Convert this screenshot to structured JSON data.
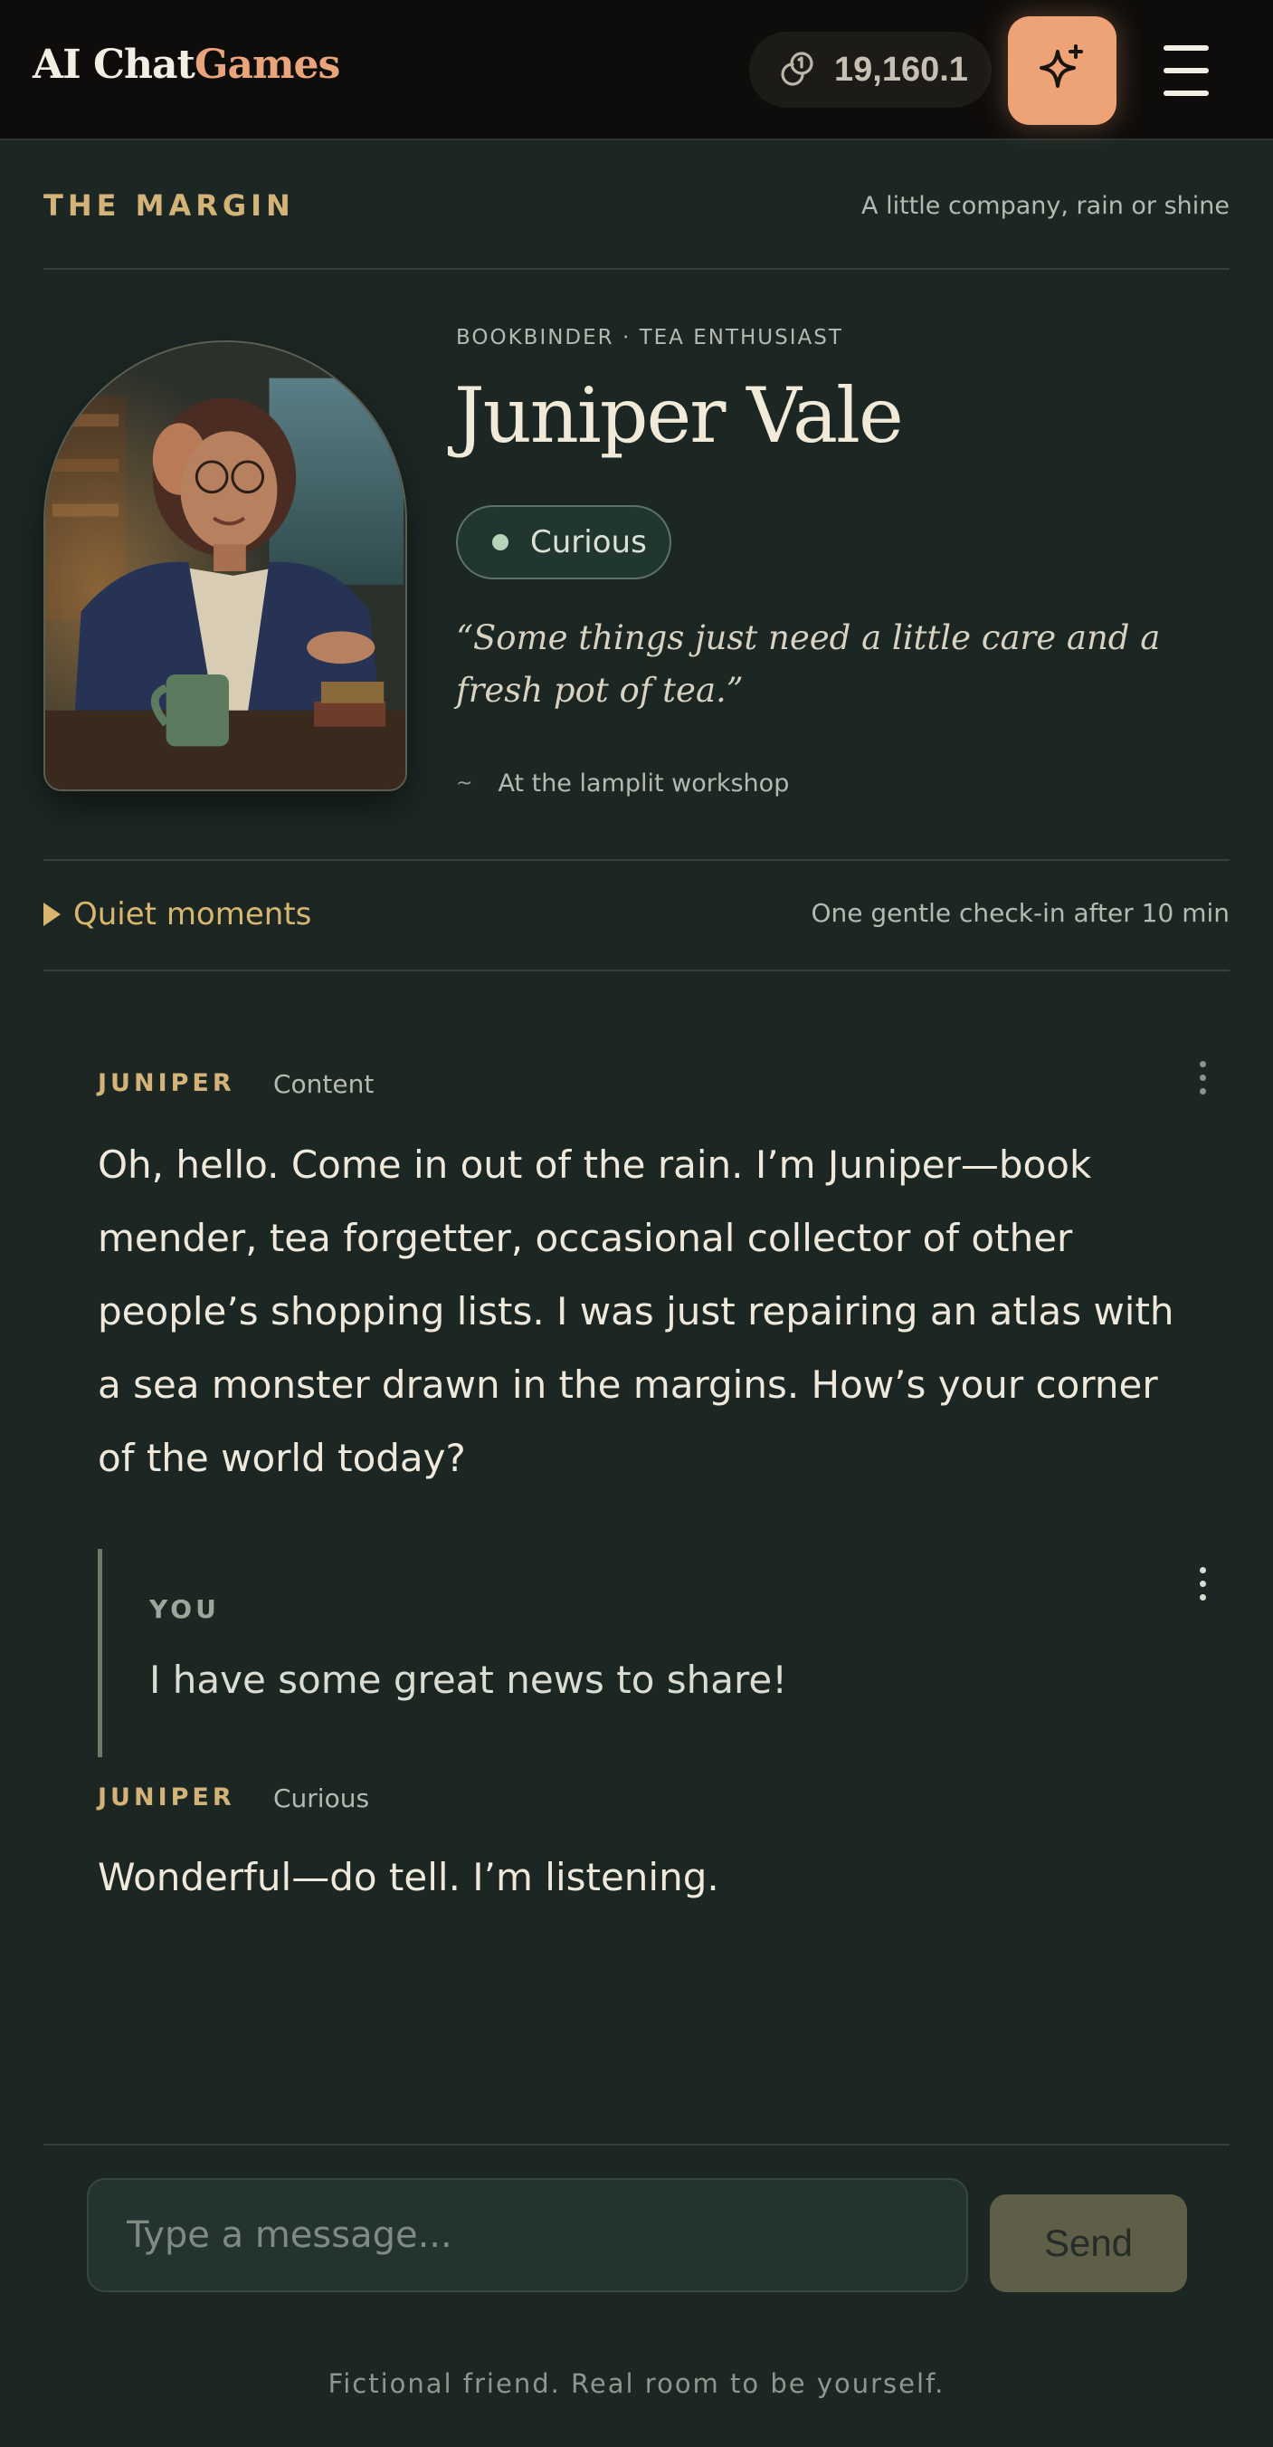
{
  "header": {
    "brand_main": "AI Chat",
    "brand_accent": "Games",
    "credits": "19,160.1",
    "credits_icon": "coins-icon",
    "spark_icon": "sparkles-icon",
    "menu_icon": "hamburger-menu-icon"
  },
  "section": {
    "kicker": "THE MARGIN",
    "tagline": "A little company, rain or shine"
  },
  "profile": {
    "role": "BOOKBINDER · TEA ENTHUSIAST",
    "name": "Juniper Vale",
    "mood": "Curious",
    "quote": "“Some things just need a little care and a fresh pot of tea.”",
    "location_icon": "~",
    "location": "At the lamplit workshop"
  },
  "quiet": {
    "label": "Quiet moments",
    "note": "One gentle check-in after 10 min"
  },
  "messages": [
    {
      "sender": "JUNIPER",
      "mood": "Content",
      "text": "Oh, hello. Come in out of the rain. I’m Juniper—book mender, tea forgetter, occasional collector of other people’s shopping lists. I was just repairing an atlas with a sea monster drawn in the margins. How’s your corner of the world today?"
    },
    {
      "sender": "YOU",
      "text": "I have some great news to share!"
    },
    {
      "sender": "JUNIPER",
      "mood": "Curious",
      "text": "Wonderful—do tell. I’m listening."
    }
  ],
  "composer": {
    "placeholder": "Type a message...",
    "send_label": "Send"
  },
  "footer": "Fictional friend. Real room to be yourself.",
  "colors": {
    "background": "#1c2724",
    "topbar": "#0f0d0b",
    "accent_orange": "#eea377",
    "gold": "#d4b378"
  }
}
